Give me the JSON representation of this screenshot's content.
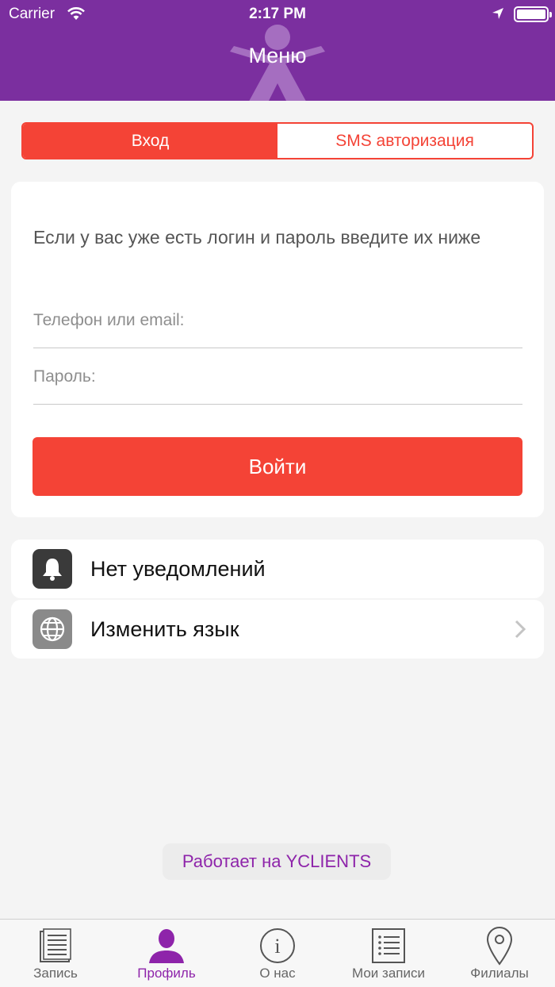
{
  "status_bar": {
    "carrier": "Carrier",
    "time": "2:17 PM"
  },
  "header": {
    "title": "Меню"
  },
  "segmented": {
    "login_tab": "Вход",
    "sms_tab": "SMS авторизация"
  },
  "login_card": {
    "intro": "Если у вас уже есть логин и пароль введите их ниже",
    "phone_placeholder": "Телефон или email:",
    "password_placeholder": "Пароль:",
    "submit_label": "Войти"
  },
  "settings": {
    "notifications_label": "Нет уведомлений",
    "language_label": "Изменить язык"
  },
  "footer": {
    "powered_by": "Работает на YCLIENTS"
  },
  "tabbar": {
    "items": [
      {
        "label": "Запись",
        "icon": "document-icon"
      },
      {
        "label": "Профиль",
        "icon": "person-icon"
      },
      {
        "label": "О нас",
        "icon": "info-icon"
      },
      {
        "label": "Мои записи",
        "icon": "list-icon"
      },
      {
        "label": "Филиалы",
        "icon": "map-pin-icon"
      }
    ],
    "active_index": 1
  },
  "colors": {
    "brand_purple": "#7b2f9f",
    "accent_red": "#f44336",
    "active_tab": "#8e24aa"
  }
}
